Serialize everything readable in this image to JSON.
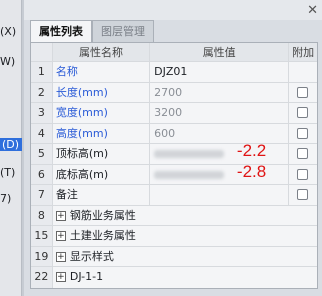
{
  "left_strip": {
    "items": [
      {
        "label": "(X)"
      },
      {
        "label": "W)"
      },
      {
        "label": "(D)"
      },
      {
        "label": "(T)"
      },
      {
        "label": "7)"
      }
    ]
  },
  "tabs": [
    {
      "label": "属性列表",
      "active": true
    },
    {
      "label": "图层管理",
      "active": false
    }
  ],
  "grid": {
    "headers": {
      "name": "属性名称",
      "value": "属性值",
      "add": "附加"
    },
    "rows": [
      {
        "num": "1",
        "name": "名称",
        "value": "DJZ01",
        "checkbox": false
      },
      {
        "num": "2",
        "name": "长度(mm)",
        "value": "2700",
        "checkbox": true
      },
      {
        "num": "3",
        "name": "宽度(mm)",
        "value": "3200",
        "checkbox": true
      },
      {
        "num": "4",
        "name": "高度(mm)",
        "value": "600",
        "checkbox": true
      },
      {
        "num": "5",
        "name": "顶标高(m)",
        "value": "-2.2",
        "checkbox": true
      },
      {
        "num": "6",
        "name": "底标高(m)",
        "value": "-2.8",
        "checkbox": true
      },
      {
        "num": "7",
        "name": "备注",
        "value": "",
        "checkbox": true
      },
      {
        "num": "8",
        "name": "钢筋业务属性"
      },
      {
        "num": "15",
        "name": "土建业务属性"
      },
      {
        "num": "19",
        "name": "显示样式"
      },
      {
        "num": "22",
        "name": "DJ-1-1"
      }
    ]
  },
  "colors": {
    "accent": "#2a5bd7",
    "annotation_red": "#e01414"
  }
}
